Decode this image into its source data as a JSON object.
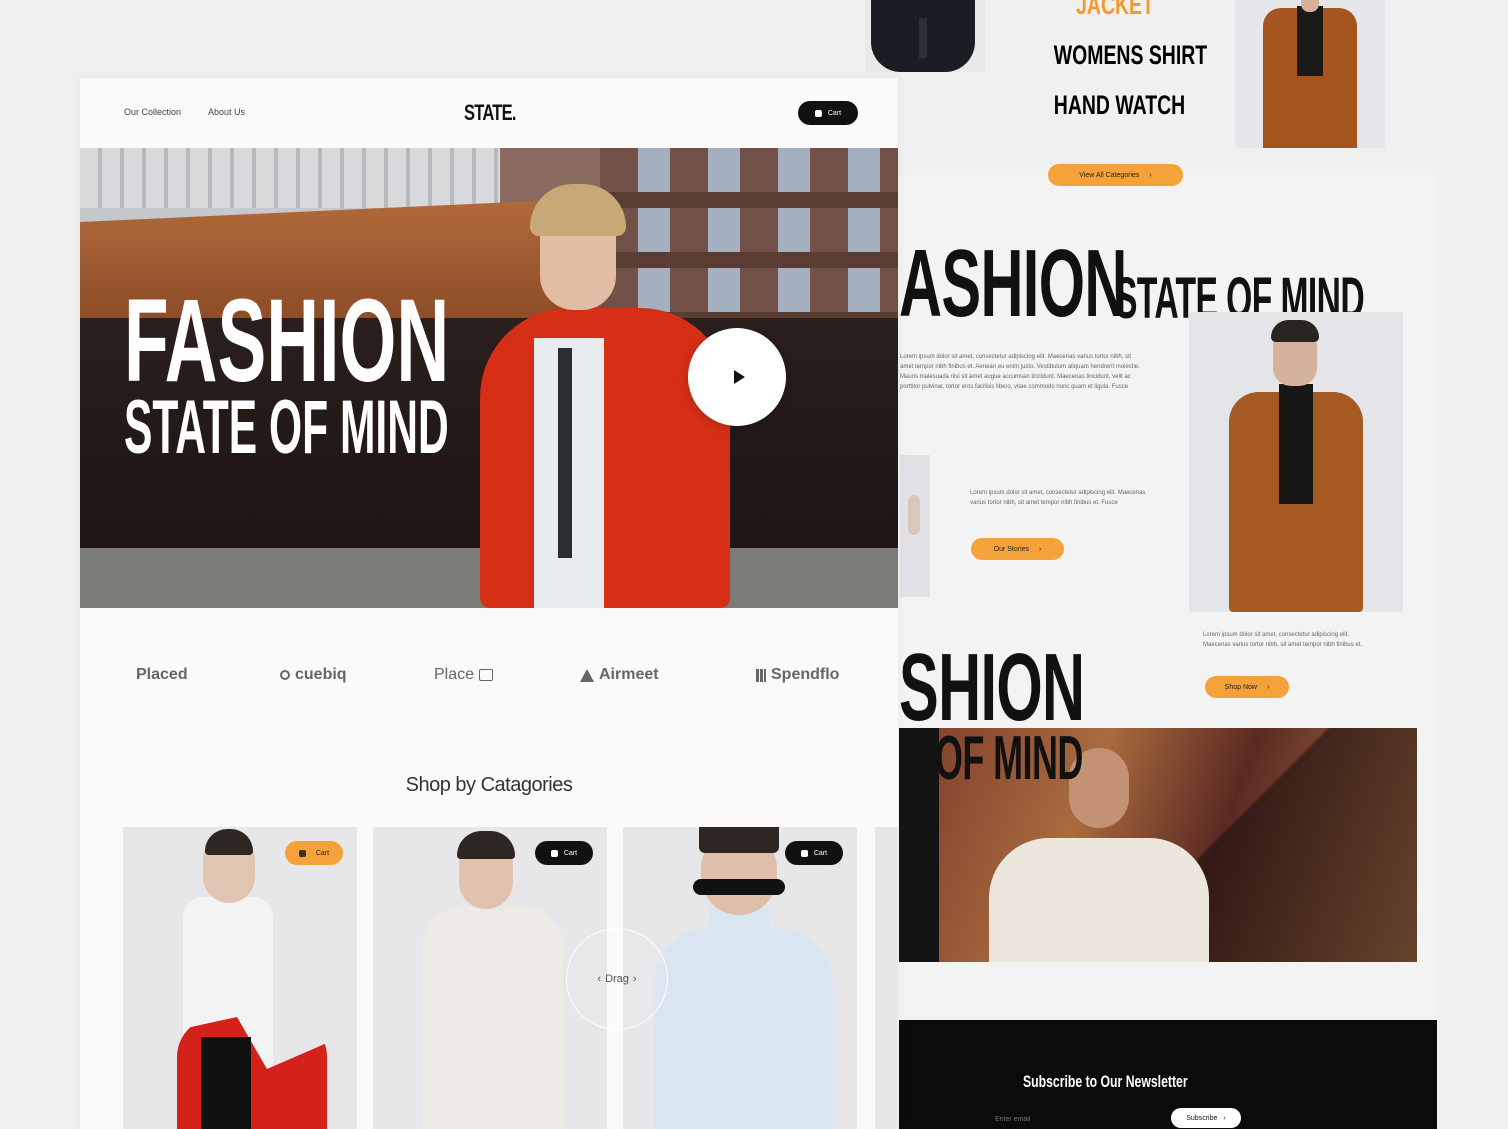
{
  "colors": {
    "accent": "#f6a23a",
    "dark": "#111111",
    "page_bg": "#fbfaf8"
  },
  "left": {
    "nav": {
      "link_1": "Our Collection",
      "link_2": "About Us",
      "logo": "STATE.",
      "cart_label": "Cart"
    },
    "hero": {
      "title_1": "FASHION",
      "title_2": "STATE OF MIND",
      "play_icon": "play-icon"
    },
    "brands": [
      "Placed",
      "cuebiq",
      "Place",
      "Airmeet",
      "Spendflo"
    ],
    "categories": {
      "title": "Shop by Catagories",
      "cart_label": "Cart",
      "drag_label": "Drag"
    }
  },
  "right": {
    "category_list": [
      "JACKET",
      "WOMENS SHIRT",
      "HAND WATCH"
    ],
    "view_all_label": "View All Categories",
    "feature": {
      "title_big": "ASHION",
      "title_small": "STATE OF MIND",
      "para_1": "Lorem ipsum dolor sit amet, consectetur adipiscing elit. Maecenas varius tortor nibh, sit amet tempor nibh finibus et. Aenean eu enim justo. Vestibulum aliquam hendrerit molestie. Mauris malesuada nisi sit amet augue accumsan tincidunt. Maecenas tincidunt, velit ac porttitor pulvinar, tortor eros facilisis libero, vitae commodo nunc quam et ligula. Fusce",
      "para_2": "Lorem ipsum dolor sit amet, consectetur adipiscing elit. Maecenas varius tortor nibh, sit amet tempor nibh finibus et. Fusce",
      "button_1": "Our Stories",
      "para_3": "Lorem ipsum dolor sit amet, consectetur adipiscing elit. Maecenas varius tortor nibh, sit amet tempor nibh finibus et.",
      "button_2": "Shop Now"
    },
    "second": {
      "title_big": "SHION",
      "title_small": "OF MIND"
    },
    "newsletter": {
      "title": "Subscribe to Our Newsletter",
      "placeholder": "Enter email",
      "button": "Subscribe"
    }
  }
}
